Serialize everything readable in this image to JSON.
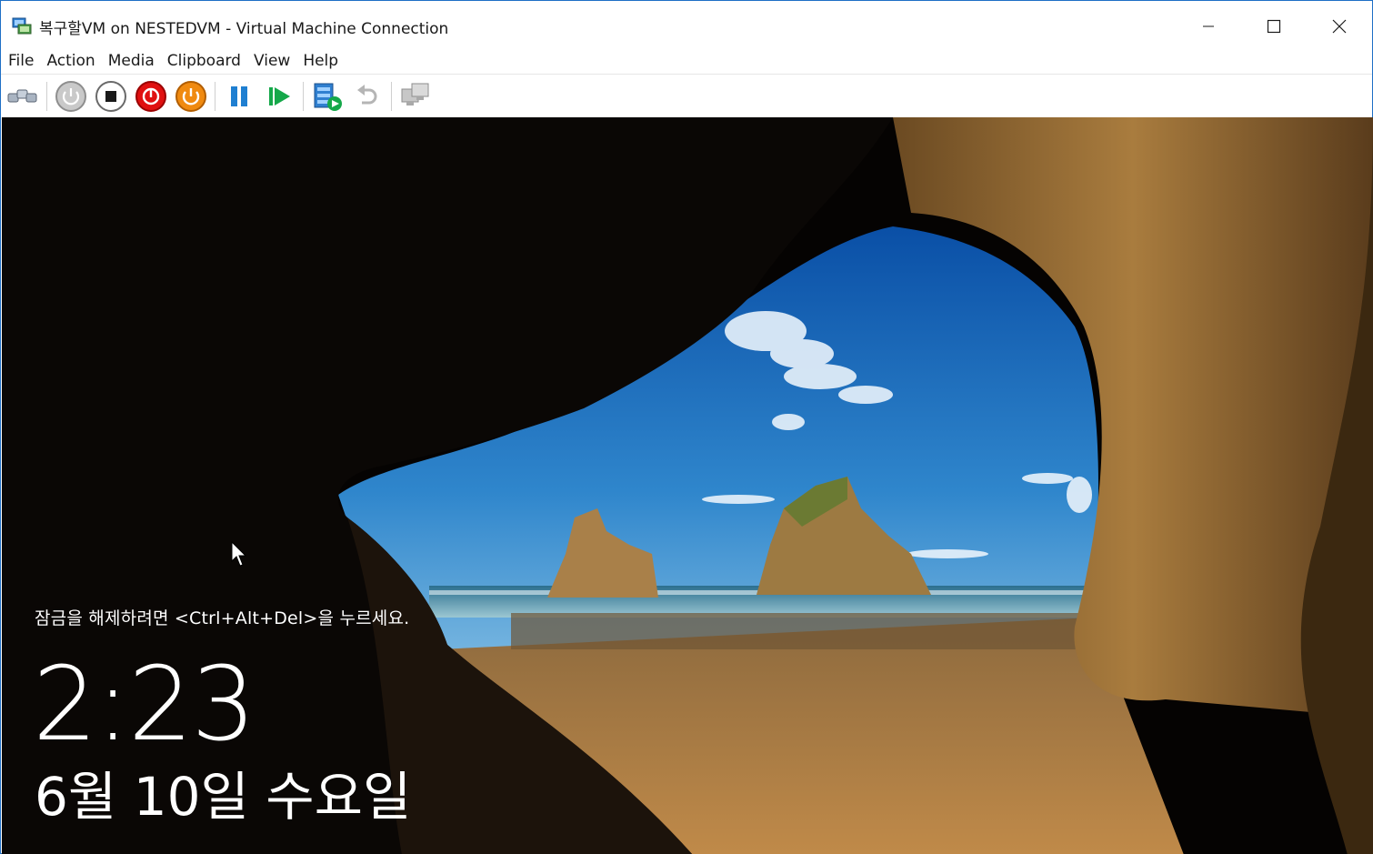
{
  "window": {
    "title": "복구할VM on NESTEDVM - Virtual Machine Connection",
    "title_icon": "vm-connection-icon"
  },
  "window_controls": {
    "minimize_icon": "minimize-icon",
    "maximize_icon": "maximize-icon",
    "close_icon": "close-icon"
  },
  "menu": {
    "items": [
      {
        "label": "File"
      },
      {
        "label": "Action"
      },
      {
        "label": "Media"
      },
      {
        "label": "Clipboard"
      },
      {
        "label": "View"
      },
      {
        "label": "Help"
      }
    ]
  },
  "toolbar": {
    "buttons": [
      {
        "icon": "ctrl-alt-del-icon"
      },
      {
        "icon": "start-icon"
      },
      {
        "icon": "turn-off-icon"
      },
      {
        "icon": "shut-down-icon"
      },
      {
        "icon": "save-icon"
      },
      {
        "icon": "pause-icon"
      },
      {
        "icon": "resume-icon"
      },
      {
        "icon": "checkpoint-icon"
      },
      {
        "icon": "revert-icon"
      },
      {
        "icon": "enhanced-session-icon"
      }
    ],
    "colors": {
      "turn_off": "#e01010",
      "shut_down": "#f08a10",
      "pause": "#1f7fd1",
      "resume": "#15a84a"
    }
  },
  "lockscreen": {
    "hint": "잠금을 해제하려면 <Ctrl+Alt+Del>을 누르세요.",
    "time": "2:23",
    "date": "6월 10일 수요일"
  },
  "colors": {
    "accent_border": "#1e6fc6",
    "sky": "#3a83c7",
    "sand": "#b07a3a"
  }
}
